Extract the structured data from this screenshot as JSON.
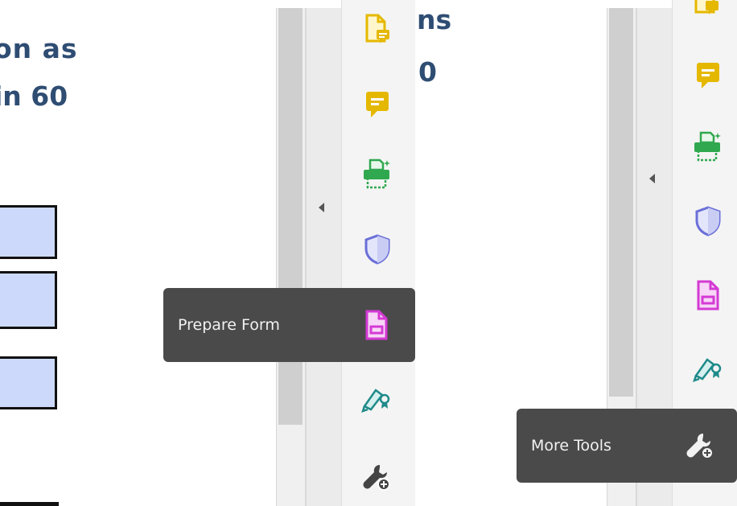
{
  "document": {
    "left_lines": [
      "on as",
      "in 60"
    ],
    "right_lines": [
      "ns",
      "0"
    ]
  },
  "left_panel": {
    "tools": [
      {
        "name": "comment-file-icon",
        "color": "#e5b800"
      },
      {
        "name": "comment-icon",
        "color": "#e5b800"
      },
      {
        "name": "scan-print-icon",
        "color": "#2fa84f"
      },
      {
        "name": "protect-shield-icon",
        "color": "#6a6fd8"
      },
      {
        "name": "prepare-form-icon",
        "color": "#d43ad4"
      },
      {
        "name": "fill-sign-icon",
        "color": "#1f8a8a"
      },
      {
        "name": "more-tools-icon",
        "color": "#444444"
      }
    ],
    "tooltip": {
      "label": "Prepare Form"
    }
  },
  "right_panel": {
    "tooltip": {
      "label": "More Tools"
    }
  }
}
